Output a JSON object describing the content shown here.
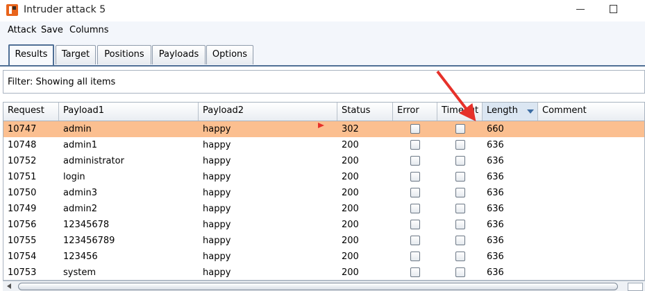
{
  "window": {
    "title": "Intruder attack 5",
    "icon": "burp-suite-icon"
  },
  "menu": [
    "Attack",
    "Save",
    "Columns"
  ],
  "tabs": [
    {
      "label": "Results",
      "active": true
    },
    {
      "label": "Target"
    },
    {
      "label": "Positions"
    },
    {
      "label": "Payloads"
    },
    {
      "label": "Options"
    }
  ],
  "filter": {
    "text": "Filter: Showing all items"
  },
  "table": {
    "columns": [
      "Request",
      "Payload1",
      "Payload2",
      "Status",
      "Error",
      "Timeout",
      "Length",
      "Comment"
    ],
    "sorted_column": "Length",
    "rows": [
      {
        "request": "10747",
        "payload1": "admin",
        "payload2": "happy",
        "status": "302",
        "error": false,
        "timeout": false,
        "length": "660",
        "comment": "",
        "selected": true
      },
      {
        "request": "10748",
        "payload1": "admin1",
        "payload2": "happy",
        "status": "200",
        "error": false,
        "timeout": false,
        "length": "636",
        "comment": ""
      },
      {
        "request": "10752",
        "payload1": "administrator",
        "payload2": "happy",
        "status": "200",
        "error": false,
        "timeout": false,
        "length": "636",
        "comment": ""
      },
      {
        "request": "10751",
        "payload1": "login",
        "payload2": "happy",
        "status": "200",
        "error": false,
        "timeout": false,
        "length": "636",
        "comment": ""
      },
      {
        "request": "10750",
        "payload1": "admin3",
        "payload2": "happy",
        "status": "200",
        "error": false,
        "timeout": false,
        "length": "636",
        "comment": ""
      },
      {
        "request": "10749",
        "payload1": "admin2",
        "payload2": "happy",
        "status": "200",
        "error": false,
        "timeout": false,
        "length": "636",
        "comment": ""
      },
      {
        "request": "10756",
        "payload1": "12345678",
        "payload2": "happy",
        "status": "200",
        "error": false,
        "timeout": false,
        "length": "636",
        "comment": ""
      },
      {
        "request": "10755",
        "payload1": "123456789",
        "payload2": "happy",
        "status": "200",
        "error": false,
        "timeout": false,
        "length": "636",
        "comment": ""
      },
      {
        "request": "10754",
        "payload1": "123456",
        "payload2": "happy",
        "status": "200",
        "error": false,
        "timeout": false,
        "length": "636",
        "comment": ""
      },
      {
        "request": "10753",
        "payload1": "system",
        "payload2": "happy",
        "status": "200",
        "error": false,
        "timeout": false,
        "length": "636",
        "comment": ""
      }
    ]
  },
  "annotation": {
    "color": "#e6312a"
  },
  "colors": {
    "selected_row": "#fbbf90",
    "accent": "#4f6f95"
  }
}
